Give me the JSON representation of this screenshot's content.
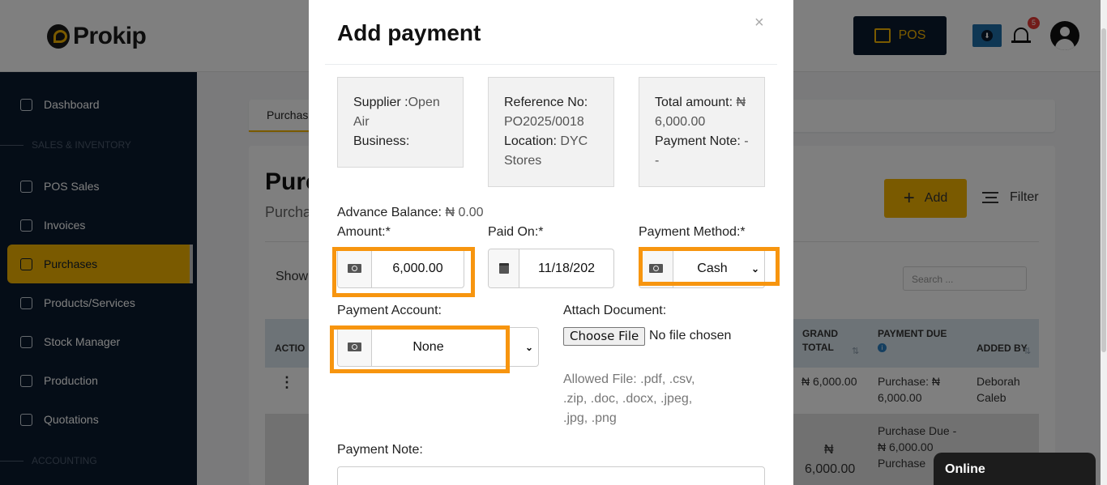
{
  "header": {
    "logo_text": "Prokip",
    "pos_label": "POS",
    "notification_count": "5"
  },
  "sidebar": {
    "items": [
      {
        "label": "Dashboard"
      },
      {
        "label": "POS Sales"
      },
      {
        "label": "Invoices"
      },
      {
        "label": "Purchases"
      },
      {
        "label": "Products/Services"
      },
      {
        "label": "Stock Manager"
      },
      {
        "label": "Production"
      },
      {
        "label": "Quotations"
      }
    ],
    "sections": [
      "SALES & INVENTORY",
      "ACCOUNTING"
    ],
    "active_item": "Purchases"
  },
  "page": {
    "tab_label": "Purchas",
    "title": "Purc",
    "subtitle": "Purcha",
    "add_label": "Add",
    "filter_label": "Filter",
    "show_label": "Show",
    "search_placeholder": "Search ...",
    "columns": {
      "action": "ACTIO",
      "grand_total": "GRAND\nTOTAL",
      "payment_due": "PAYMENT DUE",
      "added_by": "ADDED BY"
    },
    "rows": [
      {
        "grand_total": "₦ 6,000.00",
        "payment_due": "Purchase: ₦\n6,000.00",
        "added_by": "Deborah\nCaleb"
      },
      {
        "grand_total_symbol": "₦",
        "grand_total": "6,000.00",
        "payment_due": "Purchase Due -\n₦ 6,000.00\nPurchase"
      }
    ]
  },
  "modal": {
    "title": "Add payment",
    "close_symbol": "×",
    "supplier_label": "Supplier :",
    "supplier_value": "Open Air",
    "business_label": "Business:",
    "reference_label": "Reference No:",
    "reference_value": "PO2025/0018",
    "location_label": "Location:",
    "location_value": "DYC Stores",
    "total_label": "Total amount:",
    "total_value": "₦ 6,000.00",
    "payment_note_label": "Payment Note:",
    "payment_note_value": "- -",
    "advance_balance_label": "Advance Balance:",
    "advance_balance_value": "₦ 0.00",
    "amount_label": "Amount:*",
    "amount_value": "6,000.00",
    "paid_on_label": "Paid On:*",
    "paid_on_value": "11/18/202",
    "method_label": "Payment Method:*",
    "method_value": "Cash",
    "account_label": "Payment Account:",
    "account_value": "None",
    "attach_label": "Attach Document:",
    "choose_file_label": "Choose File",
    "no_file_label": "No file chosen",
    "allowed_files": "Allowed File: .pdf, .csv, .zip, .doc, .docx, .jpeg, .jpg, .png",
    "note_label": "Payment Note:"
  },
  "status": {
    "online_label": "Online"
  },
  "colors": {
    "brand_yellow": "#f5b400",
    "sidebar_bg": "#0b1a2e",
    "highlight_orange": "#f7950f"
  },
  "icons": [
    "dashboard-icon",
    "cart-icon",
    "invoice-icon",
    "purchase-icon",
    "box-icon",
    "stock-icon",
    "factory-icon",
    "quote-icon",
    "money-icon",
    "calendar-icon",
    "bell-icon",
    "download-icon",
    "user-icon"
  ]
}
